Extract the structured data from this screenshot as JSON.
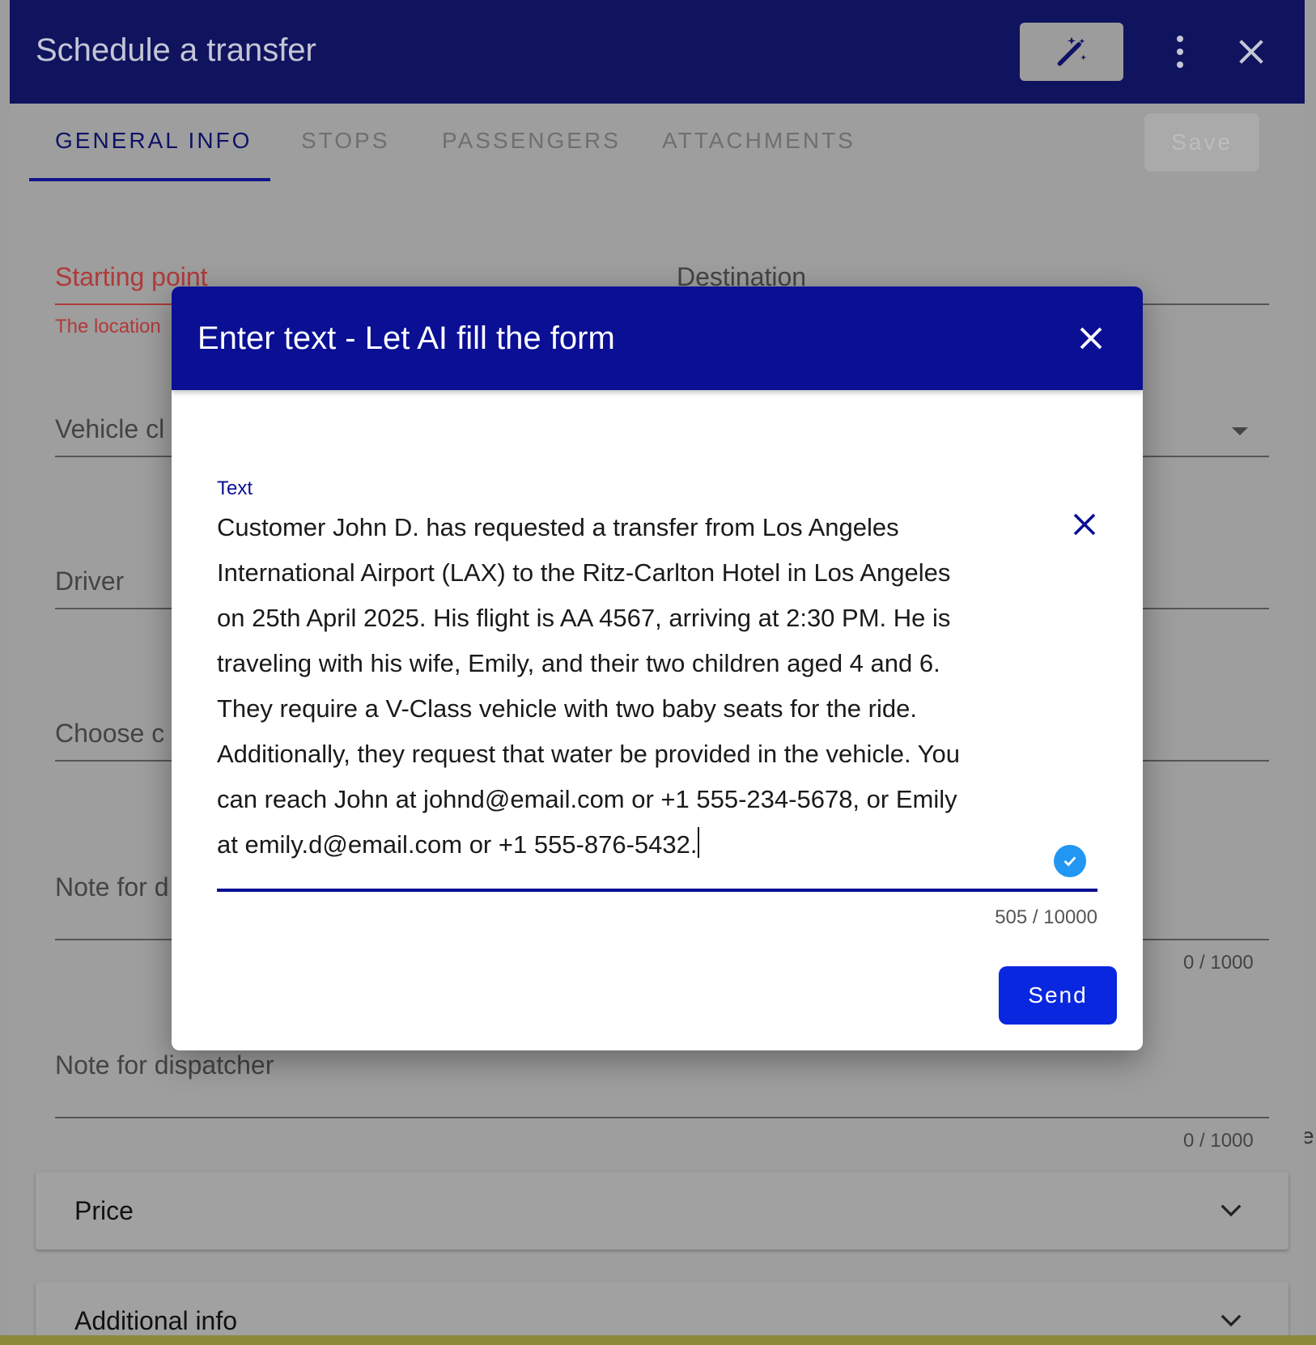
{
  "app": {
    "title": "Schedule a transfer",
    "icons": {
      "magic": "magic-wand-icon",
      "more": "more-vert-icon",
      "close": "close-icon"
    }
  },
  "tabs": [
    {
      "label": "GENERAL INFO",
      "active": true
    },
    {
      "label": "STOPS",
      "active": false
    },
    {
      "label": "PASSENGERS",
      "active": false
    },
    {
      "label": "ATTACHMENTS",
      "active": false
    }
  ],
  "toolbar": {
    "save_label": "Save"
  },
  "form": {
    "starting_point": {
      "label": "Starting point",
      "error": "The location"
    },
    "destination": {
      "label": "Destination"
    },
    "vehicle_class": {
      "label": "Vehicle cl"
    },
    "driver": {
      "label": "Driver"
    },
    "choose": {
      "label": "Choose c"
    },
    "note_for_driver": {
      "label": "Note for d",
      "counter": "0 / 1000"
    },
    "note_for_dispatcher": {
      "label": "Note for dispatcher",
      "counter": "0 / 1000"
    }
  },
  "background_edge_text": "e",
  "accordions": [
    {
      "label": "Price"
    },
    {
      "label": "Additional info"
    }
  ],
  "dialog": {
    "title": "Enter text - Let AI fill the form",
    "field_label": "Text",
    "text_value": "Customer John D. has requested a transfer from Los Angeles\nInternational Airport (LAX) to the Ritz-Carlton Hotel in Los Angeles\non 25th April 2025. His flight is AA 4567, arriving at 2:30 PM. He is\ntraveling with his wife, Emily, and their two children aged 4 and 6.\nThey require a V-Class vehicle with two baby seats for the ride.\nAdditionally, they request that water be provided in the vehicle. You\ncan reach John at johnd@email.com or +1 555-234-5678, or Emily\nat emily.d@email.com or +1 555-876-5432.",
    "counter": "505 / 10000",
    "send_label": "Send"
  },
  "colors": {
    "app_header": "#10145e",
    "dialog_header": "#0a0f94",
    "send_button": "#0a27e0",
    "error": "#b03a3a",
    "check": "#2196f3"
  }
}
